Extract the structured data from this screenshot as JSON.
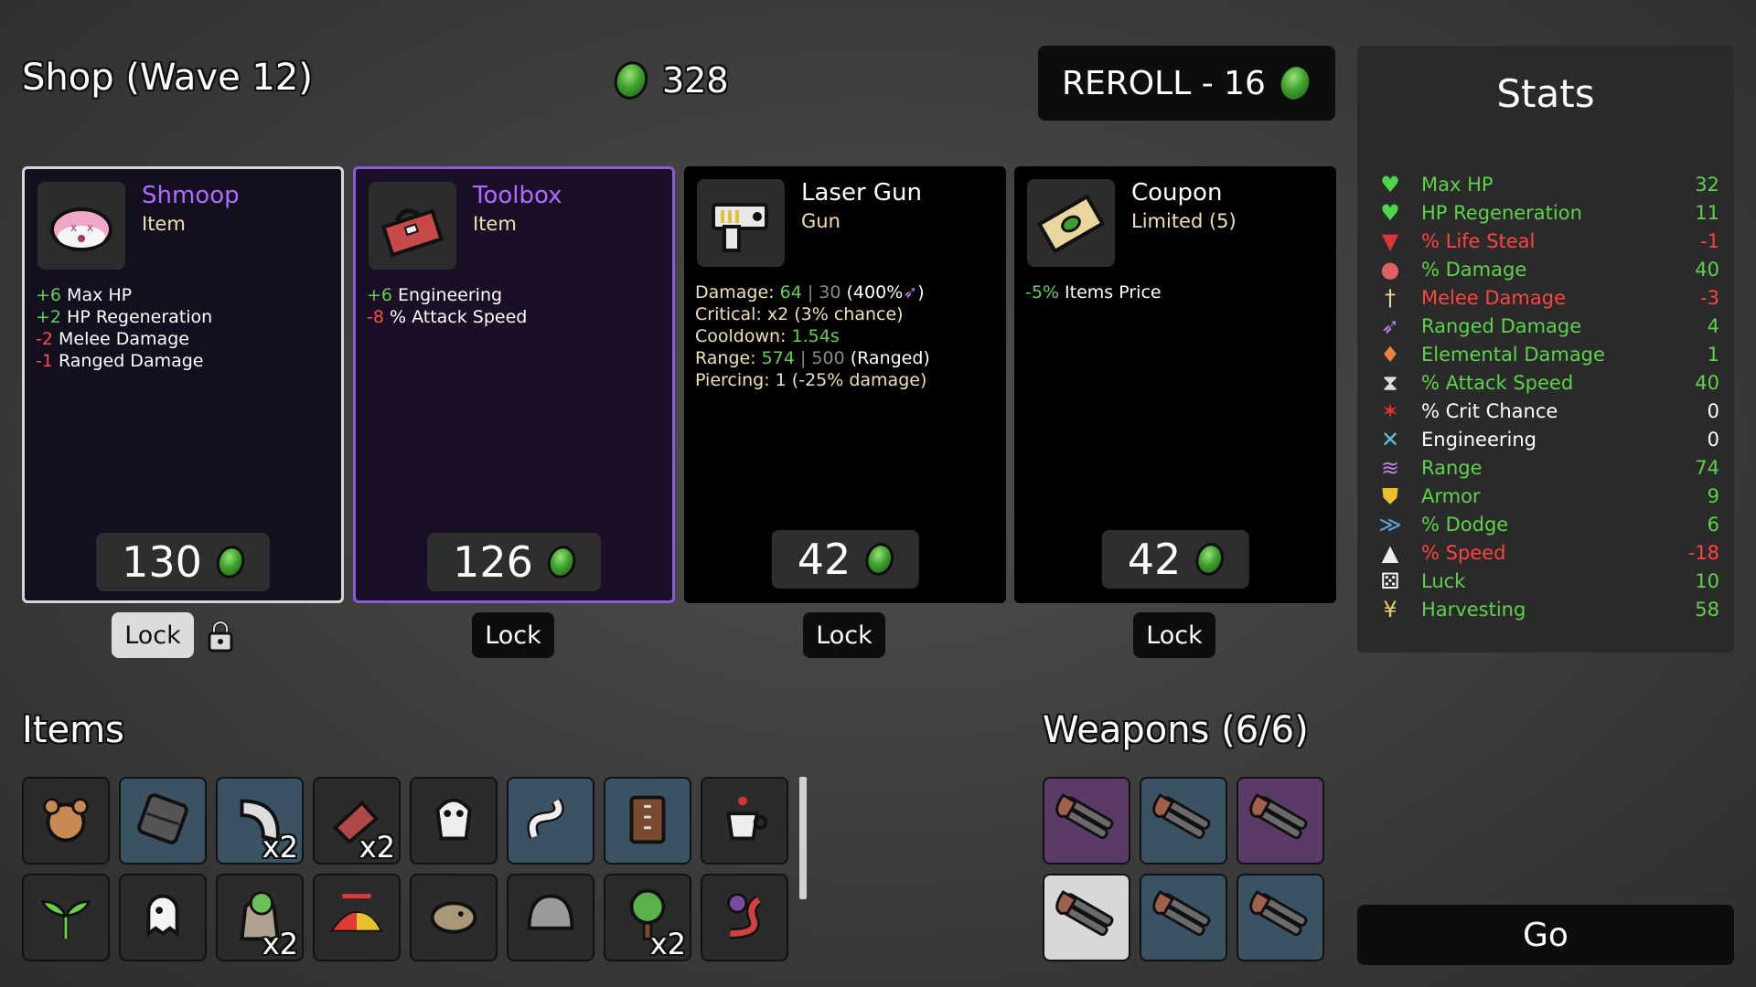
{
  "header": {
    "shop_title": "Shop (Wave 12)",
    "gold": "328",
    "reroll_label": "REROLL - 16"
  },
  "cards": [
    {
      "name": "Shmoop",
      "type": "Item",
      "name_color": "#b06aff",
      "icon": "shmoop-icon",
      "stats": [
        {
          "value": "+6",
          "label": " Max HP",
          "sign": "pos"
        },
        {
          "value": "+2",
          "label": " HP Regeneration",
          "sign": "pos"
        },
        {
          "value": "-2",
          "label": " Melee Damage",
          "sign": "neg"
        },
        {
          "value": "-1",
          "label": " Ranged Damage",
          "sign": "neg"
        }
      ],
      "price": "130",
      "lock_label": "Lock"
    },
    {
      "name": "Toolbox",
      "type": "Item",
      "name_color": "#b06aff",
      "icon": "toolbox-icon",
      "stats": [
        {
          "value": "+6",
          "label": " Engineering",
          "sign": "pos"
        },
        {
          "value": "-8",
          "label": " % Attack Speed",
          "sign": "neg"
        }
      ],
      "price": "126",
      "lock_label": "Lock"
    },
    {
      "name": "Laser Gun",
      "type": "Gun",
      "name_color": "#ffffff",
      "icon": "laser-gun-icon",
      "weapon_stats": {
        "damage_label": "Damage: ",
        "damage": "64",
        "sep": " | ",
        "base_damage": "30",
        "scaling": " (400%",
        "critical": "Critical: x2 (3% chance)",
        "cooldown_label": "Cooldown: ",
        "cooldown": "1.54s",
        "range_label": "Range: ",
        "range": "574",
        "base_range": "500",
        "range_type": " (Ranged)",
        "piercing": "Piercing: 1 (-25% damage)"
      },
      "price": "42",
      "lock_label": "Lock"
    },
    {
      "name": "Coupon",
      "type": "Limited (5)",
      "name_color": "#ffffff",
      "icon": "coupon-icon",
      "stats": [
        {
          "value": "-5%",
          "label": " Items Price",
          "sign": "pos"
        }
      ],
      "price": "42",
      "lock_label": "Lock"
    }
  ],
  "stats": {
    "title": "Stats",
    "rows": [
      {
        "label": "Max HP",
        "value": "32",
        "color": "g",
        "icon": "heart-icon"
      },
      {
        "label": "HP Regeneration",
        "value": "11",
        "color": "g",
        "icon": "heart-plus-icon"
      },
      {
        "label": "% Life Steal",
        "value": "-1",
        "color": "r",
        "icon": "fangs-icon"
      },
      {
        "label": "% Damage",
        "value": "40",
        "color": "g",
        "icon": "muscle-icon"
      },
      {
        "label": "Melee Damage",
        "value": "-3",
        "color": "r",
        "icon": "sword-icon"
      },
      {
        "label": "Ranged Damage",
        "value": "4",
        "color": "g",
        "icon": "bow-icon"
      },
      {
        "label": "Elemental Damage",
        "value": "1",
        "color": "g",
        "icon": "flame-icon"
      },
      {
        "label": "% Attack Speed",
        "value": "40",
        "color": "g",
        "icon": "hourglass-icon"
      },
      {
        "label": "% Crit Chance",
        "value": "0",
        "color": "w",
        "icon": "crit-icon"
      },
      {
        "label": "Engineering",
        "value": "0",
        "color": "w",
        "icon": "wrench-icon"
      },
      {
        "label": "Range",
        "value": "74",
        "color": "g",
        "icon": "range-icon"
      },
      {
        "label": "Armor",
        "value": "9",
        "color": "g",
        "icon": "shield-icon"
      },
      {
        "label": "% Dodge",
        "value": "6",
        "color": "g",
        "icon": "dodge-icon"
      },
      {
        "label": "% Speed",
        "value": "-18",
        "color": "r",
        "icon": "boot-icon"
      },
      {
        "label": "Luck",
        "value": "10",
        "color": "g",
        "icon": "dice-icon"
      },
      {
        "label": "Harvesting",
        "value": "58",
        "color": "g",
        "icon": "wheat-icon"
      }
    ]
  },
  "items": {
    "title": "Items",
    "slots": [
      {
        "icon": "teddy-bear-icon",
        "qty": ""
      },
      {
        "icon": "armor-plate-icon",
        "qty": ""
      },
      {
        "icon": "blade-icon",
        "qty": "x2"
      },
      {
        "icon": "gentle-alien-icon",
        "qty": "x2"
      },
      {
        "icon": "skull-icon",
        "qty": ""
      },
      {
        "icon": "worm-icon",
        "qty": ""
      },
      {
        "icon": "leather-vest-icon",
        "qty": ""
      },
      {
        "icon": "coffee-icon",
        "qty": ""
      },
      {
        "icon": "sprout-icon",
        "qty": ""
      },
      {
        "icon": "ghost-icon",
        "qty": ""
      },
      {
        "icon": "bag-icon",
        "qty": "x2"
      },
      {
        "icon": "propeller-hat-icon",
        "qty": ""
      },
      {
        "icon": "creature-icon",
        "qty": ""
      },
      {
        "icon": "helmet-icon",
        "qty": ""
      },
      {
        "icon": "tree-icon",
        "qty": "x2"
      },
      {
        "icon": "snake-icon",
        "qty": ""
      }
    ]
  },
  "weapons": {
    "title": "Weapons (6/6)",
    "slots": [
      {
        "icon": "double-barrel-shotgun-icon",
        "tier": "purple"
      },
      {
        "icon": "double-barrel-shotgun-icon",
        "tier": "blue"
      },
      {
        "icon": "double-barrel-shotgun-icon",
        "tier": "purple"
      },
      {
        "icon": "double-barrel-shotgun-icon",
        "tier": "light"
      },
      {
        "icon": "double-barrel-shotgun-icon",
        "tier": "blue"
      },
      {
        "icon": "double-barrel-shotgun-icon",
        "tier": "blue"
      }
    ]
  },
  "go_label": "Go"
}
